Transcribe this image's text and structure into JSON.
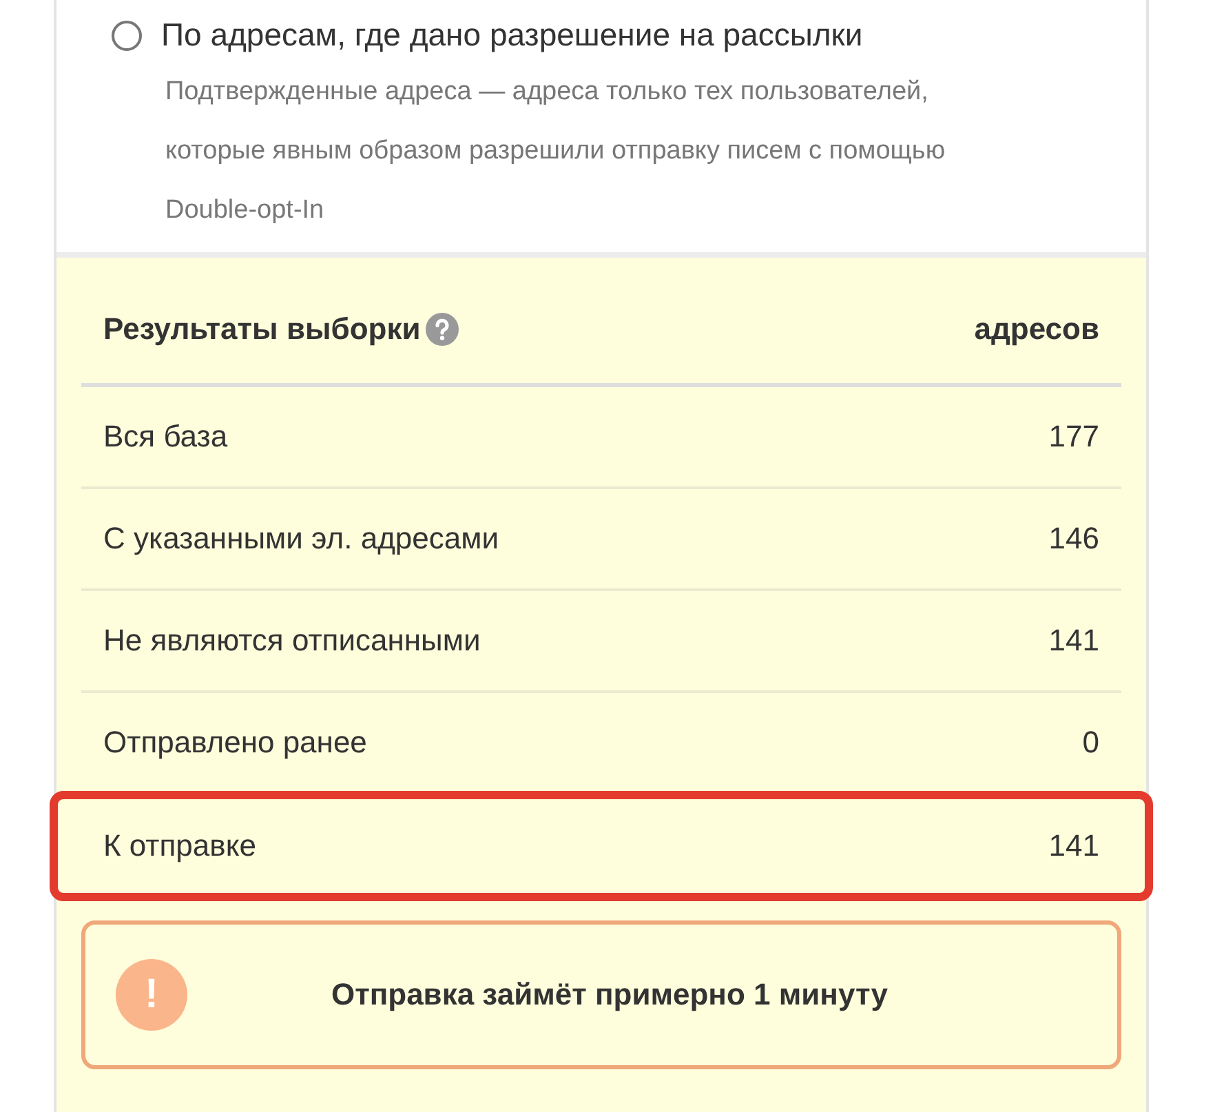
{
  "option": {
    "selected": false,
    "label": "По адресам, где дано разрешение на рассылки",
    "description": "Подтвержденные адреса — адреса только тех пользователей, которые явным образом разрешили отправку писем с помощью Double-opt-In"
  },
  "results": {
    "title": "Результаты выборки",
    "column": "адресов",
    "rows": [
      {
        "label": "Вся база",
        "value": "177",
        "highlighted": false
      },
      {
        "label": "С указанными эл. адресами",
        "value": "146",
        "highlighted": false
      },
      {
        "label": "Не являются отписанными",
        "value": "141",
        "highlighted": false
      },
      {
        "label": "Отправлено ранее",
        "value": "0",
        "highlighted": false
      },
      {
        "label": "К отправке",
        "value": "141",
        "highlighted": true
      }
    ]
  },
  "notice": {
    "icon": "!",
    "text": "Отправка займёт примерно 1 минуту"
  }
}
